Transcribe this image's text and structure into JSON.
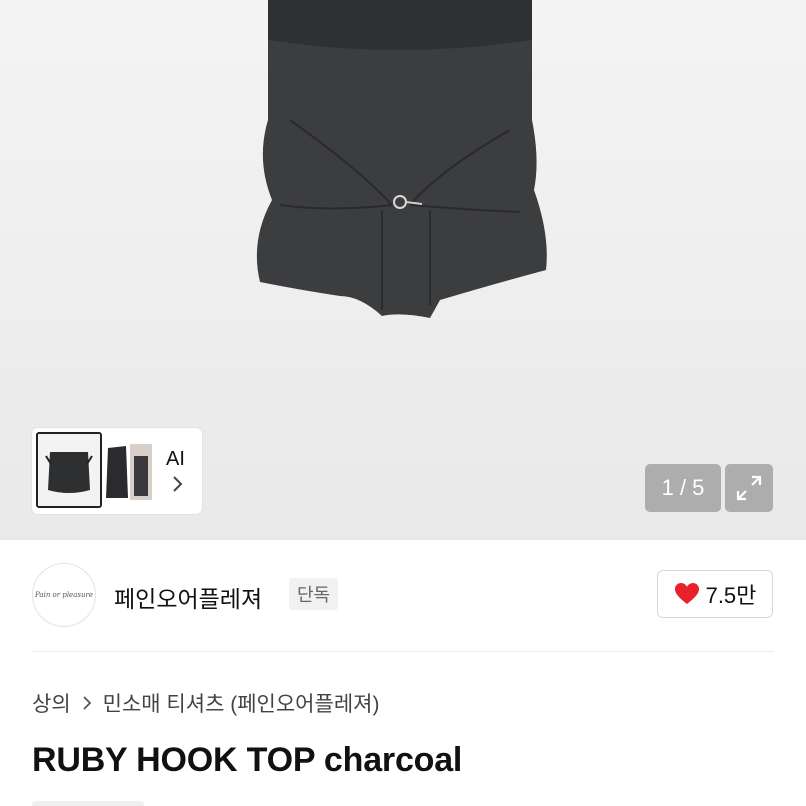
{
  "gallery": {
    "current_page": "1",
    "total_pages": "5",
    "pager_text": "1 / 5",
    "ai_label": "AI"
  },
  "seller": {
    "avatar_text": "Pain or pleasure",
    "name": "페인오어플레져",
    "badge": "단독",
    "like_count": "7.5만",
    "like_color": "#e8212a"
  },
  "breadcrumb": {
    "items": [
      "상의",
      "민소매 티셔츠 (페인오어플레져)"
    ]
  },
  "product": {
    "title": "RUBY HOOK TOP charcoal"
  },
  "icons": {
    "heart": "heart-icon",
    "expand": "expand-icon",
    "chevron": "chevron-right-icon"
  }
}
